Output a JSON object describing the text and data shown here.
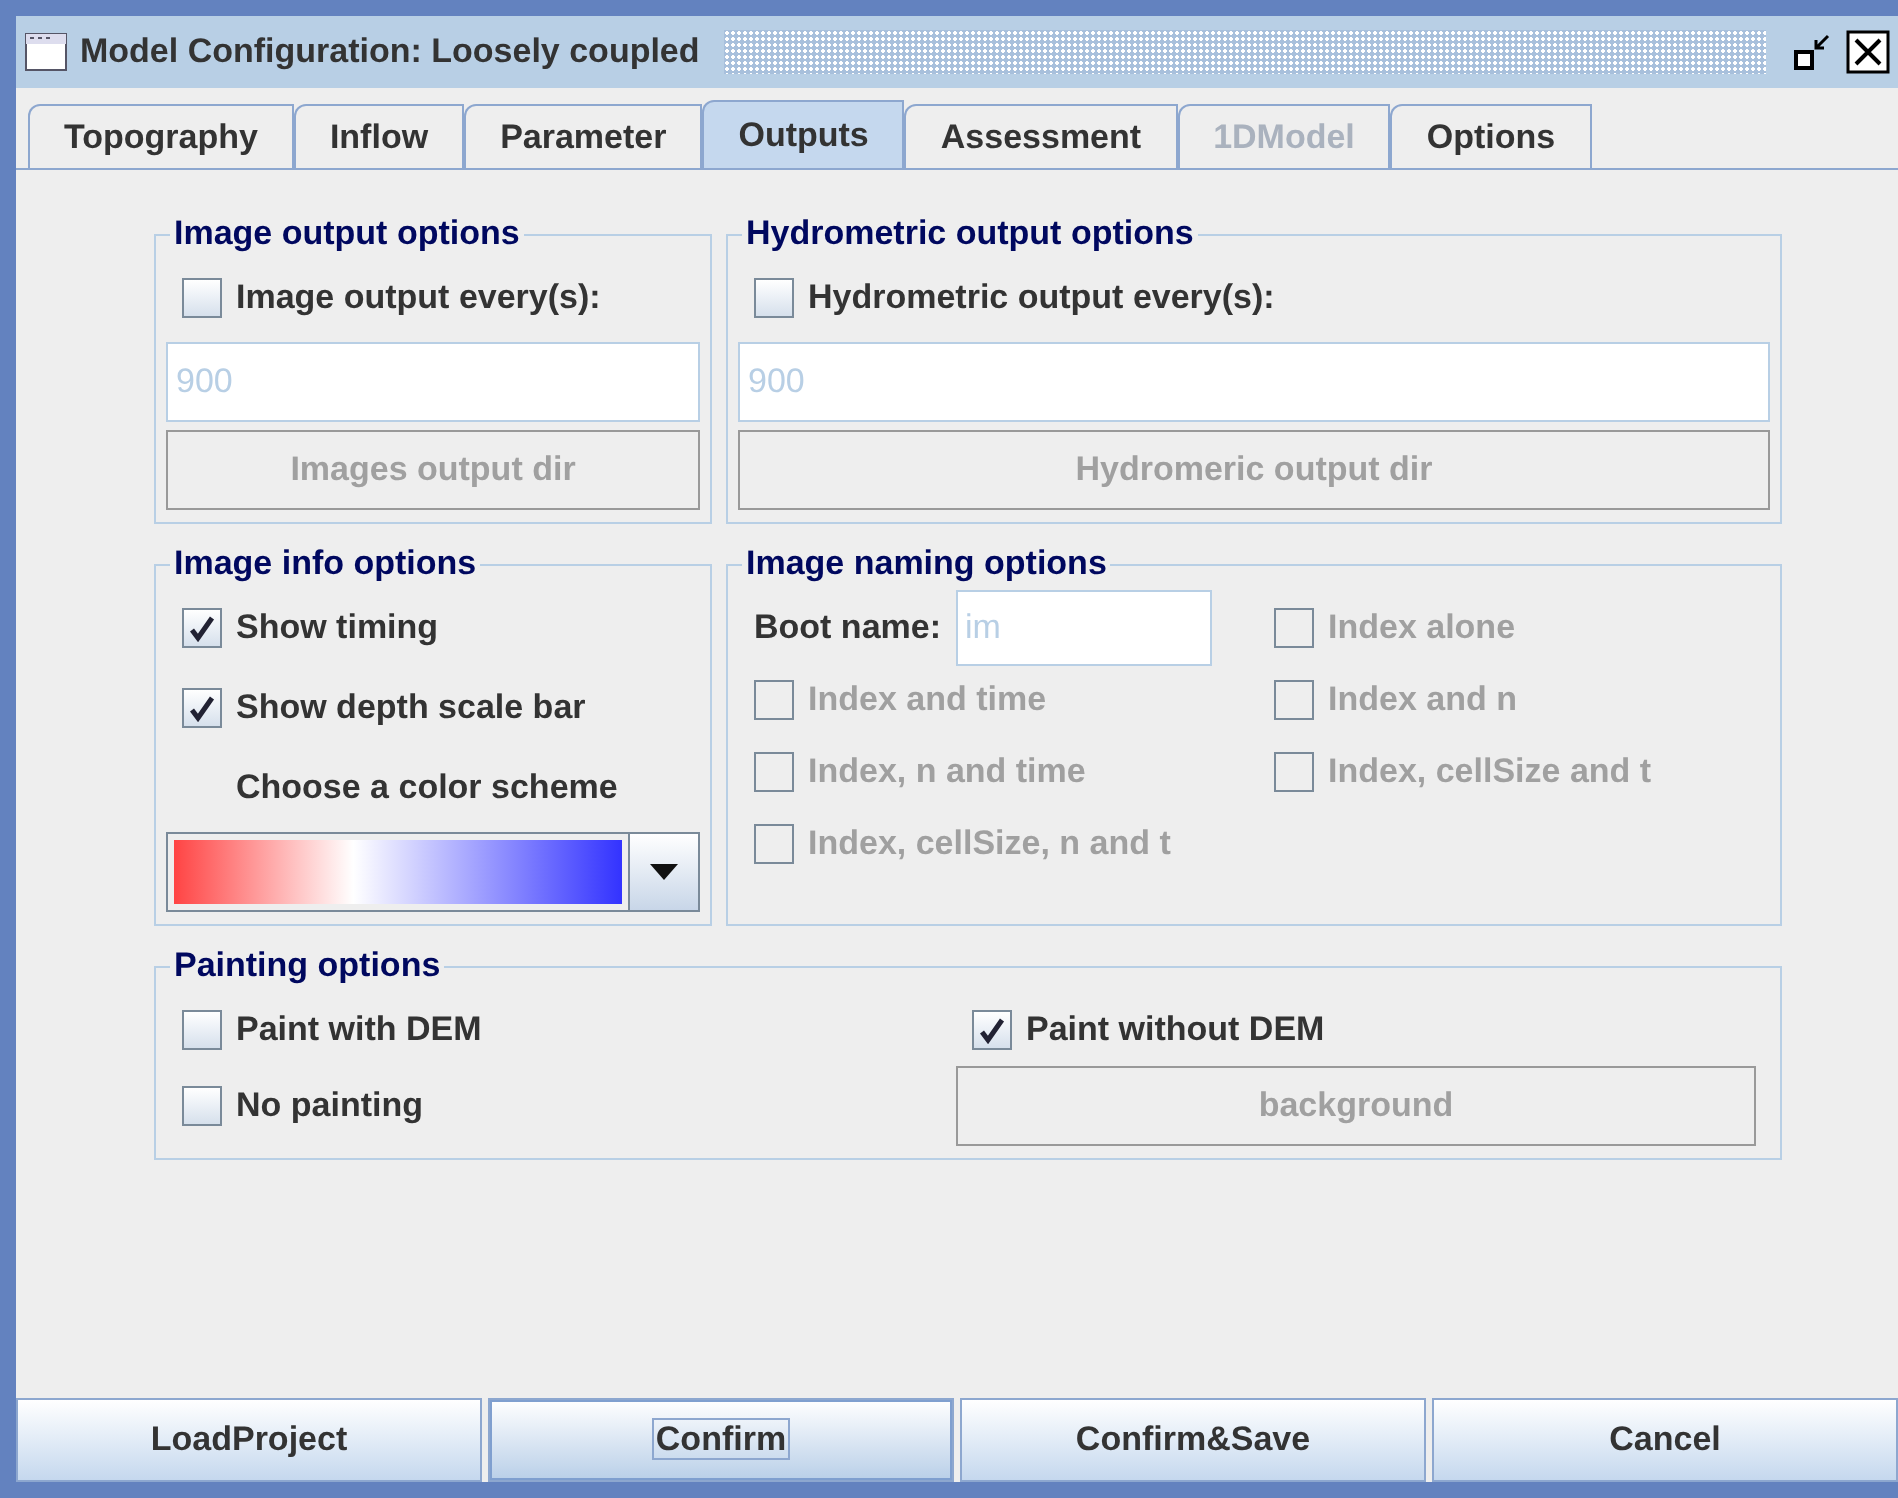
{
  "window": {
    "title": "Model Configuration: Loosely coupled"
  },
  "tabs": [
    {
      "label": "Topography",
      "selected": false,
      "disabled": false
    },
    {
      "label": "Inflow",
      "selected": false,
      "disabled": false
    },
    {
      "label": "Parameter",
      "selected": false,
      "disabled": false
    },
    {
      "label": "Outputs",
      "selected": true,
      "disabled": false
    },
    {
      "label": "Assessment",
      "selected": false,
      "disabled": false
    },
    {
      "label": "1DModel",
      "selected": false,
      "disabled": true
    },
    {
      "label": "Options",
      "selected": false,
      "disabled": false
    }
  ],
  "image_output": {
    "title": "Image output options",
    "checkbox": {
      "label": "Image output every(s):",
      "checked": false,
      "disabled": false
    },
    "field": {
      "value": "900",
      "disabled": true
    },
    "button": {
      "label": "Images output dir",
      "disabled": true
    }
  },
  "hydrometric_output": {
    "title": "Hydrometric output options",
    "checkbox": {
      "label": "Hydrometric output every(s):",
      "checked": false,
      "disabled": false
    },
    "field": {
      "value": "900",
      "disabled": true
    },
    "button": {
      "label": "Hydromeric output dir",
      "disabled": true
    }
  },
  "image_info": {
    "title": "Image info options",
    "checkboxes": [
      {
        "label": "Show timing",
        "checked": true,
        "disabled": false
      },
      {
        "label": "Show depth scale bar",
        "checked": true,
        "disabled": false
      }
    ],
    "color_scheme_label": "Choose a color scheme"
  },
  "image_naming": {
    "title": "Image naming options",
    "boot_name_label": "Boot name:",
    "boot_name": {
      "value": "im",
      "disabled": true
    },
    "checkboxes": [
      {
        "label": "Index alone",
        "checked": false,
        "disabled": true
      },
      {
        "label": "Index and time",
        "checked": false,
        "disabled": true
      },
      {
        "label": "Index and n",
        "checked": false,
        "disabled": true
      },
      {
        "label": "Index, n and time",
        "checked": false,
        "disabled": true
      },
      {
        "label": "Index, cellSize and t",
        "checked": false,
        "disabled": true
      },
      {
        "label": "Index, cellSize, n and t",
        "checked": false,
        "disabled": true
      }
    ]
  },
  "painting": {
    "title": "Painting options",
    "checkboxes": [
      {
        "label": "Paint with DEM",
        "checked": false,
        "disabled": false
      },
      {
        "label": "Paint without DEM",
        "checked": true,
        "disabled": false
      },
      {
        "label": "No painting",
        "checked": false,
        "disabled": false
      }
    ],
    "button": {
      "label": "background",
      "disabled": true
    }
  },
  "buttons": [
    {
      "label": "LoadProject",
      "focused": false
    },
    {
      "label": "Confirm",
      "focused": true
    },
    {
      "label": "Confirm&Save",
      "focused": false
    },
    {
      "label": "Cancel",
      "focused": false
    }
  ]
}
